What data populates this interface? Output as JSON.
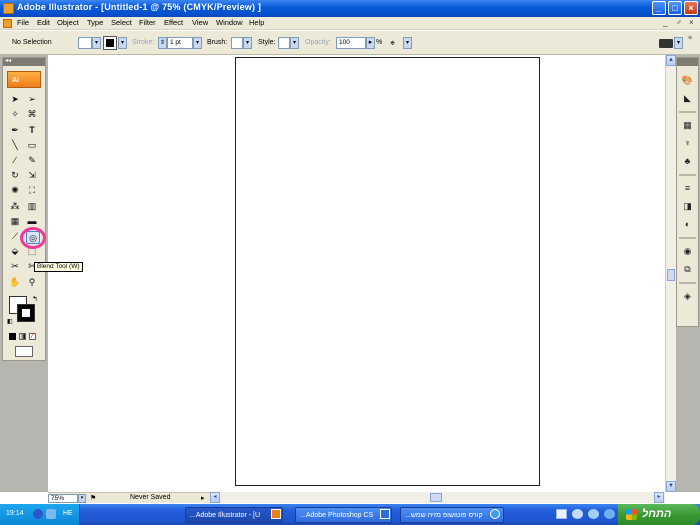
{
  "window": {
    "title": "Adobe Illustrator - [Untitled-1 @ 75% (CMYK/Preview) ]",
    "minimize_glyph": "_",
    "maximize_glyph": "□",
    "close_glyph": "×"
  },
  "menu": {
    "items": [
      "File",
      "Edit",
      "Object",
      "Type",
      "Select",
      "Filter",
      "Effect",
      "View",
      "Window",
      "Help"
    ],
    "doc_controls": [
      "_",
      "♂",
      "×"
    ]
  },
  "control_bar": {
    "selection_label": "No Selection",
    "stroke_label": "Stroke:",
    "stroke_value": "1 pt",
    "brush_label": "Brush:",
    "style_label": "Style:",
    "opacity_label": "Opacity:",
    "opacity_value": "100",
    "opacity_unit": "%"
  },
  "tools": {
    "header": "◂◂",
    "logo": "Ai",
    "tooltip": "Blend Tool (W)"
  },
  "status": {
    "zoom": "75%",
    "save_state": "Never Saved"
  },
  "taskbar": {
    "clock": "19:14",
    "lang": "HE",
    "tasks": [
      "...Adobe Illustrator - [U",
      "...Adobe Photoshop CS",
      "...קורס פוטושופ מזיה שמש"
    ],
    "start_label": "התחל"
  },
  "colors": {
    "titlebar": "#0a5bd8",
    "chrome": "#ece9d8",
    "gutter": "#b6b5b0",
    "highlight_ring": "#ee3b9b",
    "ai_orange": "#f07c1a",
    "start_green": "#3a9a34"
  }
}
